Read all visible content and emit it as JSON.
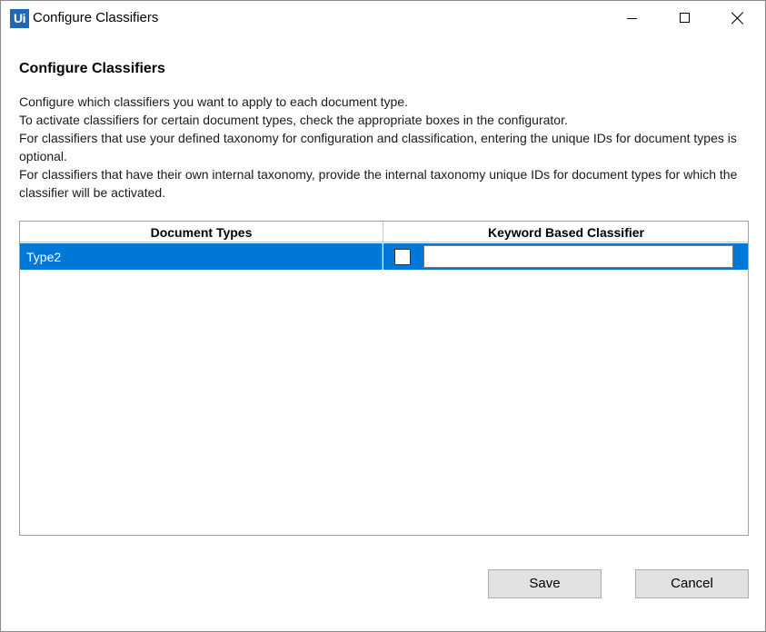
{
  "window": {
    "title": "Configure Classifiers",
    "app_logo_text": "Ui",
    "accent_color": "#0078d7"
  },
  "content": {
    "heading": "Configure Classifiers",
    "description": [
      "Configure which classifiers you want to apply to each document type.",
      "To activate classifiers for certain document types, check the appropriate boxes in the configurator.",
      "For classifiers that use your defined taxonomy for configuration and classification, entering the unique IDs for document types is optional.",
      "For classifiers that have their own internal taxonomy, provide the internal taxonomy unique IDs for document types for which the classifier will be activated."
    ]
  },
  "grid": {
    "columns": [
      "Document Types",
      "Keyword Based Classifier"
    ],
    "rows": [
      {
        "document_type": "Type2",
        "keyword_checked": false,
        "keyword_id": ""
      }
    ]
  },
  "buttons": {
    "save": "Save",
    "cancel": "Cancel"
  },
  "icons": {
    "minimize": "minimize-icon",
    "maximize": "maximize-icon",
    "close": "close-icon"
  }
}
